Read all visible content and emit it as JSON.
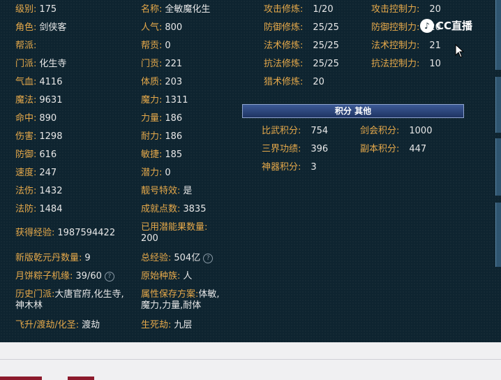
{
  "left_col": [
    {
      "label": "级别:",
      "value": "175"
    },
    {
      "label": "角色:",
      "value": "剑侠客"
    },
    {
      "label": "帮派:",
      "value": ""
    },
    {
      "label": "门派:",
      "value": "化生寺"
    },
    {
      "label": "气血:",
      "value": "4116"
    },
    {
      "label": "魔法:",
      "value": "9631"
    },
    {
      "label": "命中:",
      "value": "890"
    },
    {
      "label": "伤害:",
      "value": "1298"
    },
    {
      "label": "防御:",
      "value": "616"
    },
    {
      "label": "速度:",
      "value": "247"
    },
    {
      "label": "法伤:",
      "value": "1432"
    },
    {
      "label": "法防:",
      "value": "1484"
    },
    {
      "label": "获得经验:",
      "value": "1987594422"
    },
    {
      "label": "新版乾元丹数量:",
      "value": "9"
    },
    {
      "label": "月饼粽子机缘:",
      "value": "39/60"
    },
    {
      "label": "历史门派:",
      "value": "大唐官府,化生寺,神木林"
    },
    {
      "label": "飞升/渡劫/化圣:",
      "value": "渡劫"
    }
  ],
  "mid_col": [
    {
      "label": "名称:",
      "value": "全敏魔化生"
    },
    {
      "label": "人气:",
      "value": "800"
    },
    {
      "label": "帮贡:",
      "value": "0"
    },
    {
      "label": "门贡:",
      "value": "221"
    },
    {
      "label": "体质:",
      "value": "203"
    },
    {
      "label": "魔力:",
      "value": "1311"
    },
    {
      "label": "力量:",
      "value": "186"
    },
    {
      "label": "耐力:",
      "value": "186"
    },
    {
      "label": "敏捷:",
      "value": "185"
    },
    {
      "label": "潜力:",
      "value": "0"
    },
    {
      "label": "靓号特效:",
      "value": "是"
    },
    {
      "label": "成就点数:",
      "value": "3835"
    },
    {
      "label": "已用潜能果数量:",
      "value": "200"
    },
    {
      "label": "总经验:",
      "value": "504亿"
    },
    {
      "label": "原始种族:",
      "value": "人"
    },
    {
      "label": "属性保存方案:",
      "value": "体敏,魔力,力量,耐体"
    },
    {
      "label": "生死劫:",
      "value": "九层"
    }
  ],
  "cultivation": [
    {
      "label": "攻击修炼:",
      "value": "1/20"
    },
    {
      "label": "防御修炼:",
      "value": "25/25"
    },
    {
      "label": "法术修炼:",
      "value": "25/25"
    },
    {
      "label": "抗法修炼:",
      "value": "25/25"
    },
    {
      "label": "猎术修炼:",
      "value": "20"
    }
  ],
  "control": [
    {
      "label": "攻击控制力:",
      "value": "20"
    },
    {
      "label": "防御控制力:",
      "value": "20"
    },
    {
      "label": "法术控制力:",
      "value": "21"
    },
    {
      "label": "抗法控制力:",
      "value": "10"
    }
  ],
  "section_title": "积分 其他",
  "scores": [
    {
      "label": "比武积分:",
      "value": "754"
    },
    {
      "label": "剑会积分:",
      "value": "1000"
    },
    {
      "label": "三界功绩:",
      "value": "396"
    },
    {
      "label": "副本积分:",
      "value": "447"
    },
    {
      "label": "神器积分:",
      "value": "3"
    }
  ],
  "help_glyph": "?",
  "watermark": {
    "icon": "♪",
    "text": "CC直播"
  },
  "colors": {
    "label": "#e6a94a",
    "value": "#e8e8e8",
    "panel": "#0e2430",
    "section_bar": "#2b457c"
  }
}
